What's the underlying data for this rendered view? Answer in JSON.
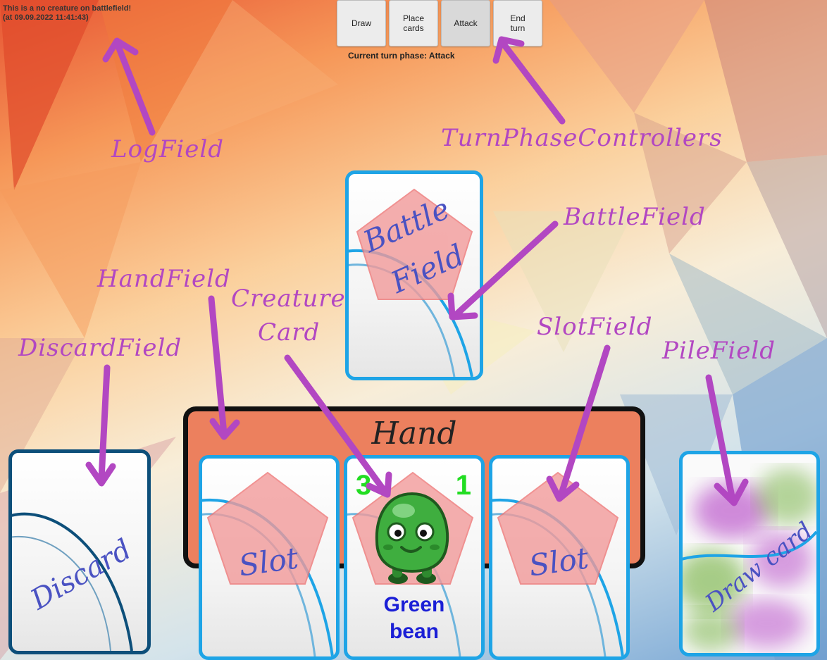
{
  "log": {
    "line1": "This is a no creature on battlefield!",
    "line2": "(at 09.09.2022 11:41:43)"
  },
  "turn_controls": {
    "buttons": [
      {
        "label_line1": "Draw",
        "label_line2": ""
      },
      {
        "label_line1": "Place",
        "label_line2": "cards"
      },
      {
        "label_line1": "Attack",
        "label_line2": ""
      },
      {
        "label_line1": "End",
        "label_line2": "turn"
      }
    ],
    "phase_text": "Current turn phase: Attack"
  },
  "annotations": {
    "log_field": "LogField",
    "turn_phase_controllers": "TurnPhaseControllers",
    "battle_field": "BattleField",
    "hand_field": "HandField",
    "creature_card_line1": "Creature",
    "creature_card_line2": "Card",
    "slot_field": "SlotField",
    "discard_field": "DiscardField",
    "pile_field": "PileField"
  },
  "battlefield": {
    "label_line1": "Battle",
    "label_line2": "Field"
  },
  "hand": {
    "title": "Hand"
  },
  "slots": [
    {
      "label": "Slot"
    },
    {
      "label": "Slot"
    }
  ],
  "creature": {
    "attack": "3",
    "health": "1",
    "name_line1": "Green",
    "name_line2": "bean"
  },
  "discard": {
    "label": "Discard"
  },
  "pile": {
    "label": "Draw card"
  },
  "colors": {
    "annotation": "#b247c2",
    "card_border": "#1ea4e6",
    "hand_panel": "#ec805e",
    "stat": "#22dd22",
    "creature_name": "#1b1fd6"
  }
}
